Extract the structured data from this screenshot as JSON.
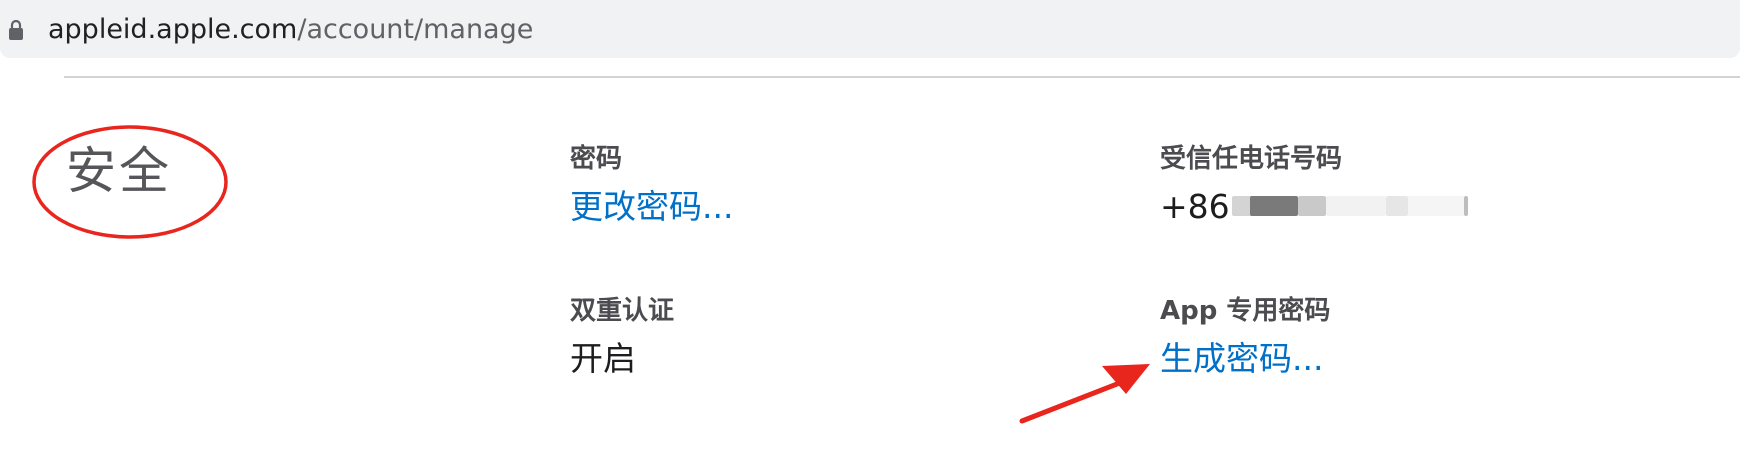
{
  "browser": {
    "url_host": "appleid.apple.com",
    "url_path": "/account/manage"
  },
  "security": {
    "title": "安全",
    "password": {
      "label": "密码",
      "action": "更改密码..."
    },
    "trusted_phone": {
      "label": "受信任电话号码",
      "value": "+86"
    },
    "two_factor": {
      "label": "双重认证",
      "value": "开启"
    },
    "app_password": {
      "label": "App 专用密码",
      "action": "生成密码..."
    }
  },
  "colors": {
    "link": "#0070c9",
    "annotation": "#e8261e"
  },
  "icons": {
    "lock": "lock-icon"
  }
}
